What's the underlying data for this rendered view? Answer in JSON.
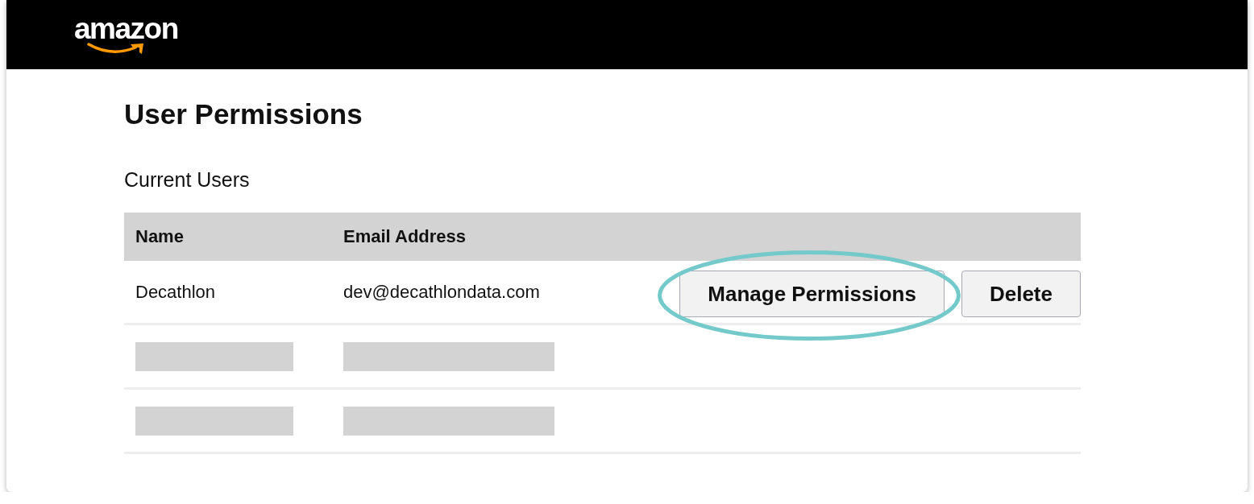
{
  "header": {
    "logo": "amazon"
  },
  "page": {
    "title": "User Permissions",
    "subtitle": "Current Users"
  },
  "table": {
    "columns": [
      "Name",
      "Email Address"
    ],
    "rows": [
      {
        "kind": "user",
        "name": "Decathlon",
        "email": "dev@decathlondata.com",
        "actions": [
          {
            "label": "Manage Permissions",
            "highlighted": true
          },
          {
            "label": "Delete",
            "highlighted": false
          }
        ]
      },
      {
        "kind": "redacted"
      },
      {
        "kind": "redacted"
      }
    ]
  }
}
